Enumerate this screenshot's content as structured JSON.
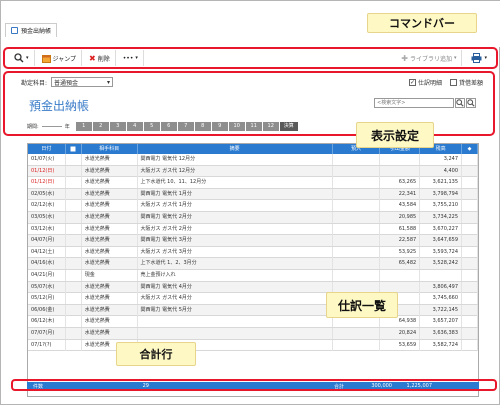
{
  "tab": {
    "title": "預金出納帳"
  },
  "toolbar": {
    "jump": "ジャンプ",
    "delete": "削除",
    "more": "•••",
    "add_library": "ライブラリ追加"
  },
  "settings": {
    "account_label": "勘定科目:",
    "account_value": "普通預金",
    "check1": "仕訳明細",
    "check2": "貸借差額",
    "title": "預金出納帳",
    "search_placeholder": "<検索文字>",
    "period_label": "期間:",
    "period_year": "年",
    "months": [
      "1",
      "2",
      "3",
      "4",
      "5",
      "6",
      "7",
      "8",
      "9",
      "10",
      "11",
      "12",
      "決算"
    ]
  },
  "table": {
    "headers": [
      "日付",
      "",
      "相手科目",
      "摘要",
      "預入",
      "引出金額",
      "残高",
      ""
    ],
    "rows": [
      {
        "date": "01/07(火)",
        "acct": "水道光熱費",
        "desc": "関西電力 電気代 12月分",
        "dep": "",
        "wd": "",
        "bal": "3,247",
        "red": false
      },
      {
        "date": "01/12(日)",
        "acct": "水道光熱費",
        "desc": "大阪ガス ガス代 12月分",
        "dep": "",
        "wd": "",
        "bal": "4,400",
        "red": true
      },
      {
        "date": "01/12(日)",
        "acct": "水道光熱費",
        "desc": "上下水道代 10、11、12月分",
        "dep": "",
        "wd": "63,265",
        "bal": "3,621,135",
        "red": true
      },
      {
        "date": "02/05(水)",
        "acct": "水道光熱費",
        "desc": "関西電力 電気代 1月分",
        "dep": "",
        "wd": "22,341",
        "bal": "3,798,794",
        "red": false
      },
      {
        "date": "02/12(水)",
        "acct": "水道光熱費",
        "desc": "大阪ガス ガス代 1月分",
        "dep": "",
        "wd": "43,584",
        "bal": "3,755,210",
        "red": false
      },
      {
        "date": "03/05(水)",
        "acct": "水道光熱費",
        "desc": "関西電力 電気代 2月分",
        "dep": "",
        "wd": "20,985",
        "bal": "3,734,225",
        "red": false
      },
      {
        "date": "03/12(水)",
        "acct": "水道光熱費",
        "desc": "大阪ガス ガス代 2月分",
        "dep": "",
        "wd": "61,588",
        "bal": "3,670,227",
        "red": false
      },
      {
        "date": "04/07(月)",
        "acct": "水道光熱費",
        "desc": "関西電力 電気代 3月分",
        "dep": "",
        "wd": "22,587",
        "bal": "3,647,659",
        "red": false
      },
      {
        "date": "04/12(土)",
        "acct": "水道光熱費",
        "desc": "大阪ガス ガス代 3月分",
        "dep": "",
        "wd": "53,925",
        "bal": "3,593,724",
        "red": false
      },
      {
        "date": "04/16(水)",
        "acct": "水道光熱費",
        "desc": "上下水道代 1、2、3月分",
        "dep": "",
        "wd": "65,482",
        "bal": "3,528,242",
        "red": false
      },
      {
        "date": "04/21(月)",
        "acct": "現金",
        "desc": "売上金預け入れ",
        "dep": "",
        "wd": "",
        "bal": "",
        "red": false
      },
      {
        "date": "05/07(水)",
        "acct": "水道光熱費",
        "desc": "関西電力 電気代 4月分",
        "dep": "",
        "wd": "",
        "bal": "3,806,497",
        "red": false
      },
      {
        "date": "05/12(月)",
        "acct": "水道光熱費",
        "desc": "大阪ガス ガス代 4月分",
        "dep": "",
        "wd": "",
        "bal": "3,745,660",
        "red": false
      },
      {
        "date": "06/06(金)",
        "acct": "水道光熱費",
        "desc": "関西電力 電気代 5月分",
        "dep": "",
        "wd": "",
        "bal": "3,722,145",
        "red": false
      },
      {
        "date": "06/12(木)",
        "acct": "水道光熱費",
        "desc": "",
        "dep": "",
        "wd": "64,938",
        "bal": "3,657,207",
        "red": false
      },
      {
        "date": "07/07(月)",
        "acct": "水道光熱費",
        "desc": "",
        "dep": "",
        "wd": "20,824",
        "bal": "3,636,383",
        "red": false
      },
      {
        "date": "07/1?(?)",
        "acct": "水道光熱費",
        "desc": "",
        "dep": "",
        "wd": "53,659",
        "bal": "3,582,724",
        "red": false
      }
    ]
  },
  "totals": {
    "label": "件数",
    "count": "29",
    "sum_label": "合計",
    "deposit": "300,000",
    "withdrawal": "1,225,007"
  },
  "callouts": {
    "command_bar": "コマンドバー",
    "display": "表示設定",
    "journal": "仕訳一覧",
    "total_row": "合計行"
  }
}
